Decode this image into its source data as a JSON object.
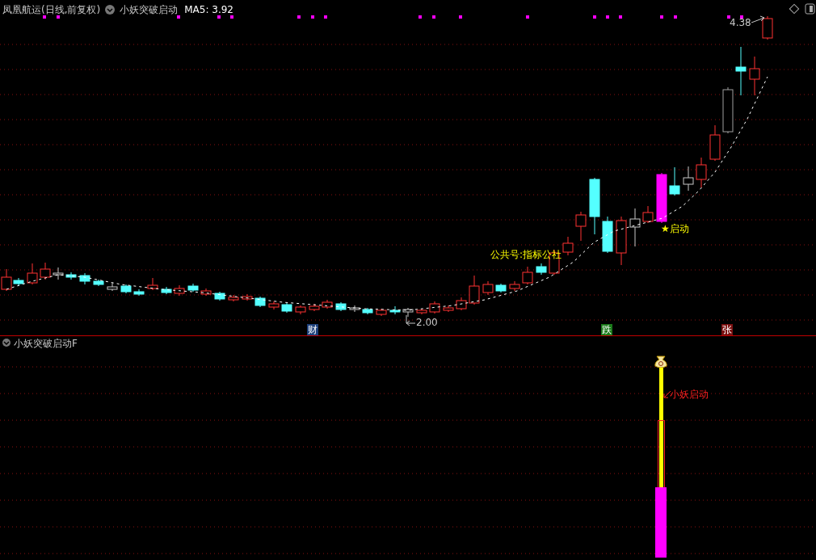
{
  "stock_panel": {
    "title": "凤凰航运(日线,前复权)",
    "indicator": "小妖突破启动",
    "ma_label": "MA5: 3.92",
    "high_label": "4.38",
    "low_label": "2.00",
    "annotations": [
      {
        "text": "公共号:指标公社"
      },
      {
        "text": "★启动"
      }
    ],
    "event_markers": [
      {
        "text": "财",
        "color": "#1c3f7a"
      },
      {
        "text": "跌",
        "color": "#1a7a1a"
      },
      {
        "text": "张",
        "color": "#7a1010"
      }
    ]
  },
  "indicator_panel": {
    "title": "小妖突破启动F",
    "signal_label": "小妖启动"
  }
}
